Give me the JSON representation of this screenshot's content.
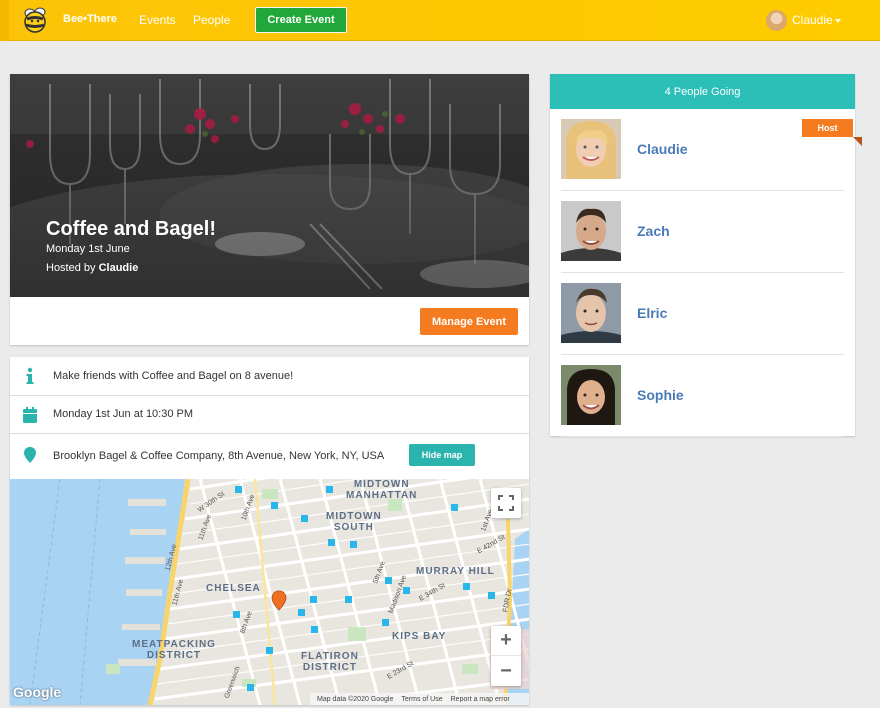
{
  "nav": {
    "brand": "Bee•There",
    "events": "Events",
    "people": "People",
    "create_event": "Create Event",
    "user_name": "Claudie"
  },
  "event": {
    "title": "Coffee and Bagel!",
    "date": "Monday 1st June",
    "hosted_by_prefix": "Hosted by ",
    "host_name": "Claudie",
    "manage_label": "Manage Event"
  },
  "details": {
    "description": "Make friends with Coffee and Bagel on 8 avenue!",
    "datetime": "Monday 1st Jun at 10:30 PM",
    "location": "Brooklyn Bagel & Coffee Company, 8th Avenue, New York, NY, USA",
    "hide_map_label": "Hide map"
  },
  "map": {
    "labels": {
      "midtown_manhattan": "MIDTOWN\nMANHATTAN",
      "midtown_south": "MIDTOWN\nSOUTH",
      "murray_hill": "MURRAY HILL",
      "chelsea": "CHELSEA",
      "kips_bay": "KIPS BAY",
      "meatpacking": "MEATPACKING\nDISTRICT",
      "flatiron": "FLATIRON\nDISTRICT"
    },
    "streets": {
      "w30": "W 30th St",
      "ave11": "11th Ave",
      "ave10": "10th Ave",
      "ave12": "12th Ave",
      "ave8": "8th Ave",
      "ave5": "5th Ave",
      "madison": "Madison Ave",
      "e34": "E 34th St",
      "e42": "E 42nd St",
      "ave1": "1st Ave",
      "fdr": "FDR Dr",
      "e23": "E 23rd St",
      "greenwich": "Greenwich"
    },
    "google": "Google",
    "footer": [
      "Map data ©2020 Google",
      "Terms of Use",
      "Report a map error"
    ],
    "zoom_in": "+",
    "zoom_out": "−"
  },
  "people": {
    "header": "4 People Going",
    "host_badge": "Host",
    "list": [
      {
        "name": "Claudie"
      },
      {
        "name": "Zach"
      },
      {
        "name": "Elric"
      },
      {
        "name": "Sophie"
      }
    ]
  },
  "colors": {
    "nav_yellow": "#fdc800",
    "create_green": "#22a83a",
    "orange": "#f47b20",
    "teal": "#2bbfb8",
    "name_blue": "#4a7bb7"
  }
}
